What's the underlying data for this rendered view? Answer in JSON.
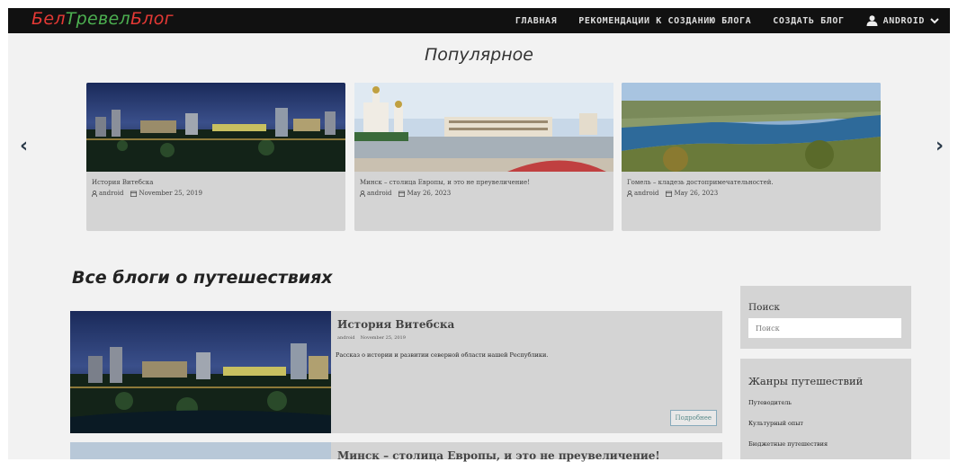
{
  "brand": {
    "part1": "Бел",
    "part2": "Тревел",
    "part3": "Блог"
  },
  "nav": {
    "links": [
      "ГЛАВНАЯ",
      "РЕКОМЕНДАЦИИ К СОЗДАНИЮ БЛОГА",
      "СОЗДАТЬ БЛОГ"
    ],
    "user": "ANDROID"
  },
  "popular": {
    "title": "Популярное",
    "cards": [
      {
        "title": "История Витебска",
        "author": "android",
        "date": "November 25, 2019"
      },
      {
        "title": "Минск – столица Европы, и это не преувеличение!",
        "author": "android",
        "date": "May 26, 2023"
      },
      {
        "title": "Гомель – кладезь достопримечательностей.",
        "author": "android",
        "date": "May 26, 2023"
      }
    ]
  },
  "blogs": {
    "title": "Все блоги о путешествиях",
    "posts": [
      {
        "title": "История Витебска",
        "author": "android",
        "date": "November 25, 2019",
        "desc": "Рассказ о истории и развитии северной области нашей Республики.",
        "more": "Подробнее"
      },
      {
        "title": "Минск – столица Европы, и это не преувеличение!"
      }
    ]
  },
  "sidebar": {
    "search_title": "Поиск",
    "search_placeholder": "Поиск",
    "genres_title": "Жанры путешествий",
    "genres": [
      "Путеводитель",
      "Культурный опыт",
      "Бюджетные путешествия"
    ]
  },
  "colors": {
    "navbar": "#111111",
    "brand_red": "#e53935",
    "brand_green": "#4caf50",
    "card_bg": "#d4d4d4"
  }
}
